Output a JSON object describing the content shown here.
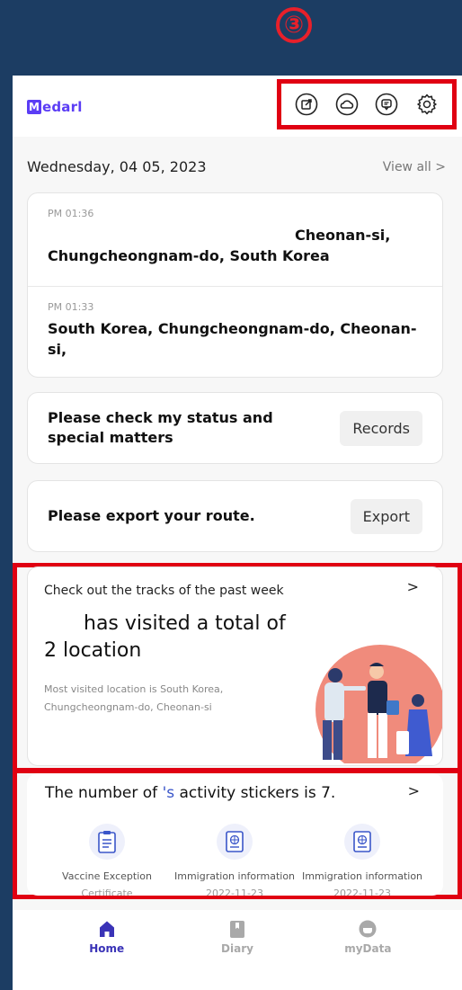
{
  "step_badge": "③",
  "app": {
    "logo_mark": "M",
    "logo_text": "edarl"
  },
  "header": {
    "icons": [
      "share-icon",
      "cloud-icon",
      "chat-icon",
      "gear-icon"
    ]
  },
  "date_row": {
    "date": "Wednesday, 04 05, 2023",
    "view_all": "View all >"
  },
  "records": [
    {
      "time": "PM 01:36",
      "place": "Cheonan-si, Chungcheongnam-do, South Korea"
    },
    {
      "time": "PM 01:33",
      "place": "South Korea, Chungcheongnam-do, Cheonan-si,"
    }
  ],
  "status_card": {
    "text": "Please check my status and special matters",
    "button": "Records"
  },
  "export_card": {
    "text": "Please export your route.",
    "button": "Export"
  },
  "week_card": {
    "top": "Check out the tracks of the past week",
    "chevron": ">",
    "headline_1": "has visited a total of",
    "headline_2": "2 location",
    "sub": "Most visited location is South Korea, Chungcheongnam-do, Cheonan-si"
  },
  "stickers": {
    "title_pre": "The number of ",
    "title_accent": "'s",
    "title_post": " activity stickers is 7.",
    "chevron": ">",
    "items": [
      {
        "label": "Vaccine Exception",
        "sub": "Certificate",
        "icon": "clipboard-icon"
      },
      {
        "label": "Immigration information",
        "sub": "2022-11-23",
        "icon": "passport-icon"
      },
      {
        "label": "Immigration information",
        "sub": "2022-11-23",
        "icon": "passport-icon"
      }
    ]
  },
  "nav": {
    "items": [
      {
        "label": "Home",
        "icon": "home-icon",
        "active": true
      },
      {
        "label": "Diary",
        "icon": "bookmark-icon",
        "active": false
      },
      {
        "label": "myData",
        "icon": "data-icon",
        "active": false
      }
    ]
  },
  "colors": {
    "accent": "#5b3df5",
    "highlight": "#e00012",
    "frame": "#1c3d63",
    "nav_active": "#3a33b7"
  }
}
